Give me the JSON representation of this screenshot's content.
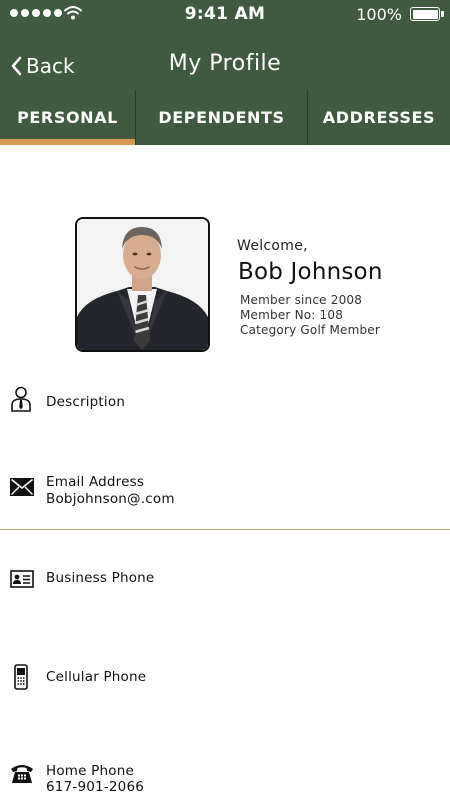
{
  "status_bar": {
    "time": "9:41 AM",
    "battery": "100%"
  },
  "nav": {
    "back_label": "Back",
    "title": "My Profile"
  },
  "tabs": [
    {
      "label": "PERSONAL",
      "active": true
    },
    {
      "label": "DEPENDENTS",
      "active": false
    },
    {
      "label": "ADDRESSES",
      "active": false
    }
  ],
  "profile": {
    "welcome": "Welcome,",
    "name": "Bob Johnson",
    "member_since": "Member since 2008",
    "member_no": "Member No: 108",
    "category": "Category Golf Member"
  },
  "rows": {
    "description": {
      "label": "Description",
      "icon": "person-tie-icon"
    },
    "email": {
      "label": "Email Address",
      "value": "Bobjohnson@.com",
      "icon": "envelope-icon"
    },
    "business_phone": {
      "label": "Business Phone",
      "icon": "contact-card-icon"
    },
    "cellular_phone": {
      "label": "Cellular Phone",
      "icon": "mobile-phone-icon"
    },
    "home_phone": {
      "label": "Home Phone",
      "value": "617-901-2066",
      "icon": "telephone-icon"
    }
  },
  "colors": {
    "header_bg": "#3f5a3f",
    "tab_active_underline": "#d9974f",
    "divider": "#b9a77a"
  }
}
